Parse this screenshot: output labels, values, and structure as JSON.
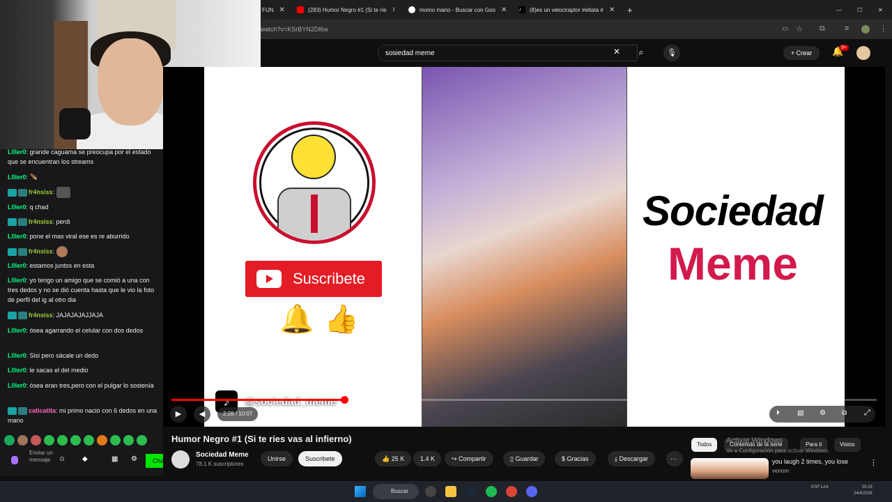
{
  "browser": {
    "tabs": [
      {
        "label": "FUN"
      },
      {
        "label": "(283) Humor Negro #1 (Si te ríe"
      },
      {
        "label": "momo mano - Buscar con Goo"
      },
      {
        "label": "(8)es un velociraptor #eltata #"
      }
    ],
    "new_tab": "+",
    "url": "watch?v=KSrBYN2Dl6w",
    "window_controls": {
      "minimize": "—",
      "maximize": "☐",
      "close": "✕"
    }
  },
  "youtube": {
    "search_value": "sosiedad meme",
    "create_label": "Crear",
    "notif_badge": "9+"
  },
  "chat": {
    "messages": [
      {
        "user": "L0ler0",
        "text": "grande caguama se preocupa por el estado que se encuentran los streams"
      },
      {
        "user": "L0ler0",
        "text": ""
      },
      {
        "user": "fr4nsiss",
        "text": ""
      },
      {
        "user": "L0ler0",
        "text": "q chad"
      },
      {
        "user": "fr4nsiss",
        "text": "perdi"
      },
      {
        "user": "L0ler0",
        "text": "pone el mas viral ese es re aburrido"
      },
      {
        "user": "fr4nsiss",
        "text": ""
      },
      {
        "user": "L0ler0",
        "text": "estamos juntos en esta"
      },
      {
        "user": "L0ler0",
        "text": "yo tengo un amigo que se comió a una con tres dedos y no se dió cuenta hasta que le vio la foto de perfil del ig al otro dia"
      },
      {
        "user": "fr4nsiss",
        "text": "JAJAJAJAJJAJA"
      },
      {
        "user": "L0ler0",
        "text": "ósea agarrando el celular con dos dedos"
      },
      {
        "user": "L0ler0",
        "text": "Sisi pero sácale un dedo"
      },
      {
        "user": "L0ler0",
        "text": "le sacas el del medio"
      },
      {
        "user": "L0ler0",
        "text": "ósea eran tres,pero con el pulgar lo sostenía"
      },
      {
        "user": "caticatita",
        "text": "mi primo nacio con 6 dedos en una mano"
      }
    ],
    "input_placeholder": "Enviar un mensaje",
    "chat_button": "Cha"
  },
  "video": {
    "subscribe_graphic": "Suscribete",
    "brand_line1": "Sociedad",
    "brand_line2": "Meme",
    "tiktok_handle": "@sociedad_meme",
    "time_current": "2:28",
    "time_total": "10:07",
    "progress_fraction": 0.245,
    "title": "Humor Negro #1 (Si te ries vas al infierno)"
  },
  "channel": {
    "name": "Sociedad Meme",
    "subscribers": "78.1 K suscriptores",
    "join": "Unirse",
    "subscribe": "Suscribete"
  },
  "actions": {
    "likes": "25 K",
    "dislikes": "1.4 K",
    "share": "Compartir",
    "save": "Guardar",
    "thanks": "Gracias",
    "download": "Descargar",
    "more": "⋯"
  },
  "sidebar": {
    "chips": [
      "Todos",
      "Contenido de la serie",
      "Para ti",
      "Vistos"
    ],
    "rec_title": "you laugh 2 times, you lose",
    "rec_channel": "venom",
    "watermark_title": "Activar Windows",
    "watermark_sub": "Ve a Configuración para activar Windows."
  },
  "taskbar": {
    "search_label": "Buscar",
    "lang": "ESP\nLAA",
    "time": "03:28",
    "date": "24/4/2026"
  }
}
